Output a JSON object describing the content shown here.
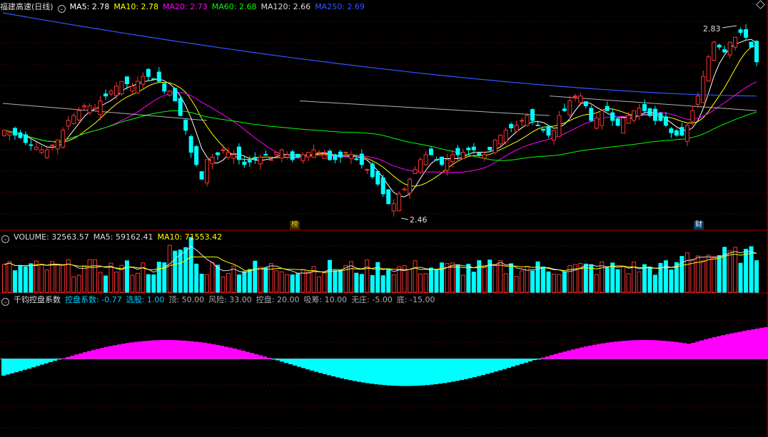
{
  "price_header": {
    "title": "福建高速(日线)",
    "items": [
      {
        "label": "MA5: 2.78",
        "color": "#ffffff"
      },
      {
        "label": "MA10: 2.78",
        "color": "#ffff00"
      },
      {
        "label": "MA20: 2.73",
        "color": "#ff00ff"
      },
      {
        "label": "MA60: 2.68",
        "color": "#00ff00"
      },
      {
        "label": "MA120: 2.66",
        "color": "#dddddd"
      },
      {
        "label": "MA250: 2.69",
        "color": "#3355ff"
      }
    ]
  },
  "volume_header": {
    "items": [
      {
        "label": "VOLUME: 32563.57",
        "color": "#dddddd"
      },
      {
        "label": "MA5: 59162.41",
        "color": "#dddddd"
      },
      {
        "label": "MA10: 71553.42",
        "color": "#ffff00"
      }
    ]
  },
  "indicator_header": {
    "items": [
      {
        "label": "千钧控盘系数",
        "color": "#dddddd"
      },
      {
        "label": "控盘系数: -0.77",
        "color": "#00ccff"
      },
      {
        "label": "选股: 1.00",
        "color": "#00ccff"
      },
      {
        "label": "顶: 50.00",
        "color": "#aaaaaa"
      },
      {
        "label": "风险: 33.00",
        "color": "#aaaaaa"
      },
      {
        "label": "控盘: 20.00",
        "color": "#aaaaaa"
      },
      {
        "label": "吸筹: 10.00",
        "color": "#aaaaaa"
      },
      {
        "label": "无庄: -5.00",
        "color": "#aaaaaa"
      },
      {
        "label": "底: -15.00",
        "color": "#aaaaaa"
      }
    ]
  },
  "annotations": {
    "high": "2.83",
    "low": "2.46",
    "badge1": "榜",
    "badge2": "财"
  },
  "colors": {
    "up": "#ff3232",
    "down": "#00ffff",
    "grid": "#800000",
    "magenta": "#ff00ff",
    "cyan": "#00ffff"
  },
  "chart_data": {
    "type": "candlestick",
    "price_ylim": [
      2.42,
      2.86
    ],
    "closes": [
      2.62,
      2.615,
      2.61,
      2.605,
      2.595,
      2.59,
      2.585,
      2.58,
      2.58,
      2.59,
      2.6,
      2.62,
      2.64,
      2.65,
      2.66,
      2.67,
      2.67,
      2.665,
      2.68,
      2.69,
      2.7,
      2.71,
      2.72,
      2.715,
      2.71,
      2.72,
      2.73,
      2.73,
      2.725,
      2.72,
      2.7,
      2.7,
      2.68,
      2.65,
      2.62,
      2.575,
      2.55,
      2.52,
      2.56,
      2.565,
      2.57,
      2.58,
      2.575,
      2.57,
      2.56,
      2.55,
      2.555,
      2.56,
      2.565,
      2.57,
      2.56,
      2.575,
      2.58,
      2.57,
      2.56,
      2.565,
      2.57,
      2.575,
      2.58,
      2.575,
      2.57,
      2.56,
      2.56,
      2.565,
      2.575,
      2.57,
      2.56,
      2.55,
      2.54,
      2.525,
      2.51,
      2.49,
      2.47,
      2.47,
      2.49,
      2.5,
      2.52,
      2.54,
      2.56,
      2.57,
      2.57,
      2.56,
      2.55,
      2.56,
      2.57,
      2.57,
      2.575,
      2.58,
      2.58,
      2.57,
      2.57,
      2.58,
      2.6,
      2.61,
      2.62,
      2.625,
      2.63,
      2.64,
      2.65,
      2.64,
      2.63,
      2.62,
      2.61,
      2.62,
      2.65,
      2.66,
      2.68,
      2.69,
      2.69,
      2.67,
      2.64,
      2.645,
      2.66,
      2.66,
      2.64,
      2.63,
      2.645,
      2.65,
      2.66,
      2.665,
      2.66,
      2.65,
      2.64,
      2.64,
      2.63,
      2.615,
      2.61,
      2.61,
      2.63,
      2.66,
      2.69,
      2.73,
      2.77,
      2.8,
      2.79,
      2.78,
      2.8,
      2.81,
      2.82,
      2.81,
      2.79,
      2.76
    ],
    "ma5_last": 2.78,
    "ma10_last": 2.78,
    "ma20_last": 2.73,
    "ma60_last": 2.68,
    "ma120_last": 2.66,
    "ma250_last": 2.69,
    "ma250_range": [
      2.86,
      2.69
    ],
    "ma120_segments": [
      [
        2.675,
        2.64
      ],
      [
        2.68,
        2.65
      ],
      [
        2.69,
        2.66
      ]
    ],
    "volume_ylim": [
      0,
      130000
    ],
    "volume_last": 32563.57,
    "volume_ma5": 59162.41,
    "volume_ma10": 71553.42,
    "indicator_ylim": [
      -7,
      5
    ],
    "indicator_levels": [
      "顶 50",
      "风险 33",
      "控盘 20",
      "吸筹 10",
      "无庄 -5",
      "底 -15"
    ],
    "indicator_last": -0.77
  }
}
